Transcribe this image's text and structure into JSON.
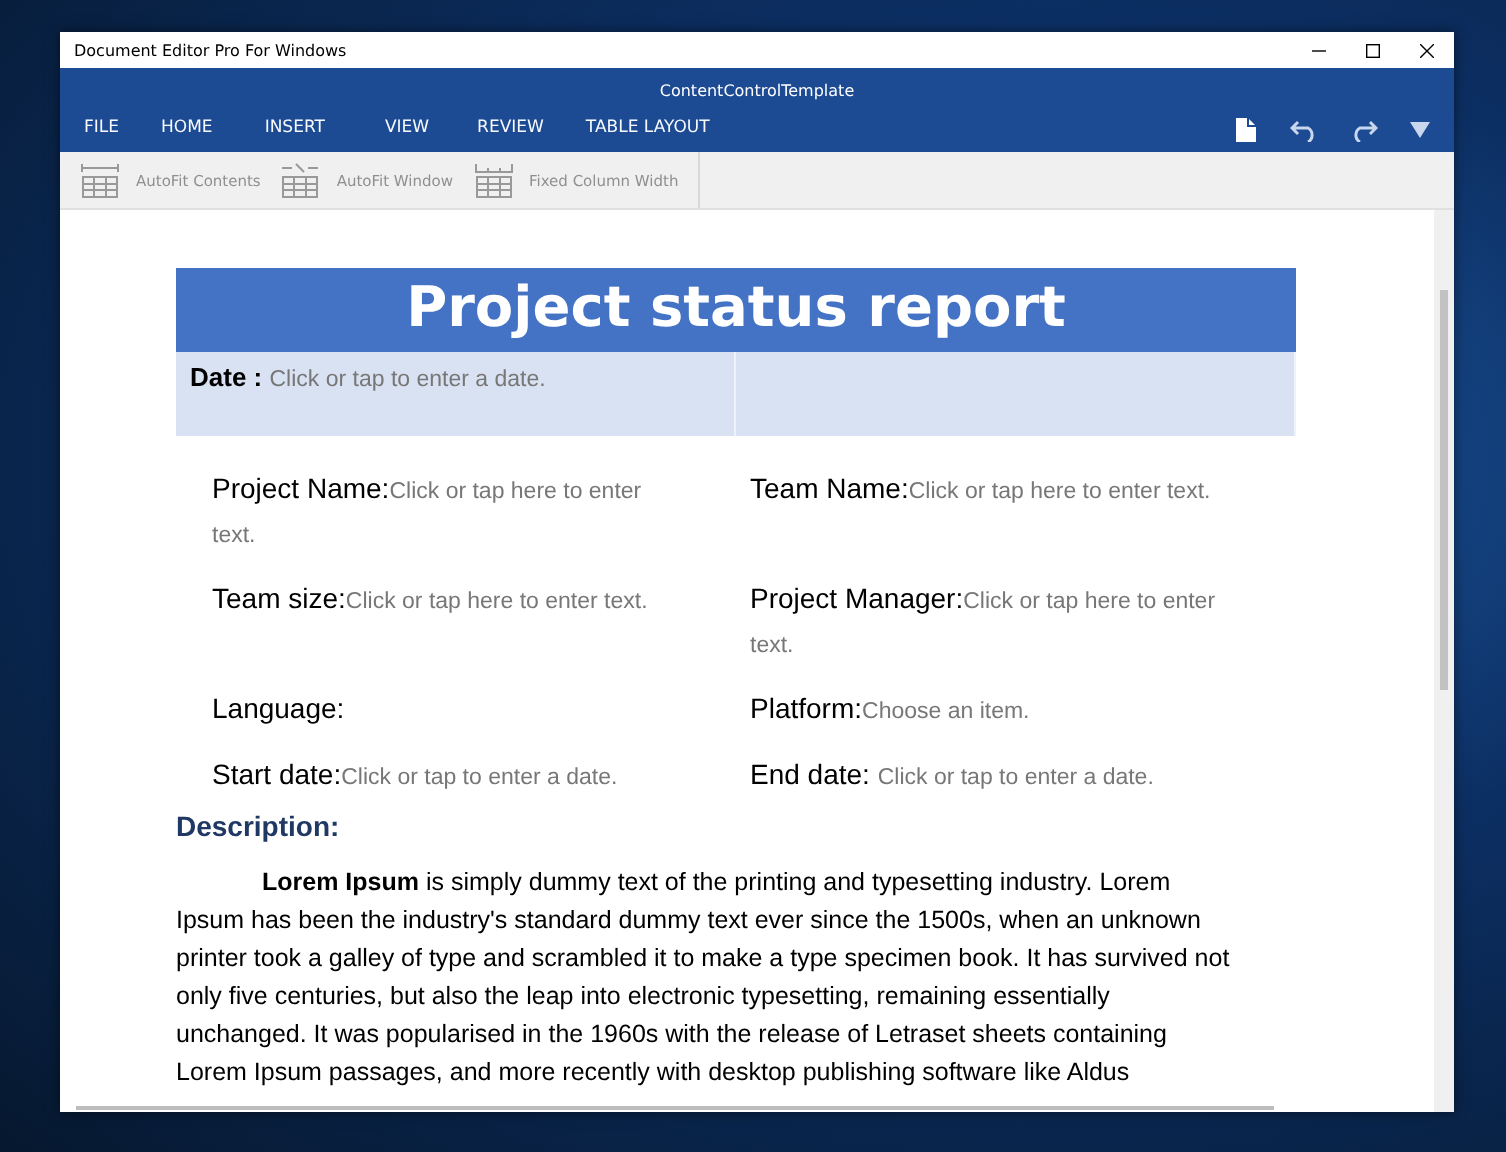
{
  "window": {
    "title": "Document Editor Pro For Windows",
    "document_title": "ContentControlTemplate"
  },
  "menu": [
    {
      "label": "FILE"
    },
    {
      "label": "HOME"
    },
    {
      "label": "INSERT"
    },
    {
      "label": "VIEW"
    },
    {
      "label": "REVIEW"
    },
    {
      "label": "TABLE LAYOUT"
    }
  ],
  "toolbar": [
    {
      "label": "AutoFit Contents",
      "kind": "contents",
      "disabled": true
    },
    {
      "label": "AutoFit Window",
      "kind": "window",
      "disabled": true
    },
    {
      "label": "Fixed Column Width",
      "kind": "fixed",
      "disabled": true
    }
  ],
  "document": {
    "heading": "Project status report",
    "date_label": "Date :",
    "date_placeholder": "Click or tap to enter a date.",
    "fields": [
      {
        "label": "Project Name:",
        "placeholder": "Click or tap here to enter text."
      },
      {
        "label": "Team Name:",
        "placeholder": "Click or tap here to enter text."
      },
      {
        "label": "Team size:",
        "placeholder": "Click or tap here to enter text."
      },
      {
        "label": "Project Manager:",
        "placeholder": "Click or tap here to enter text."
      },
      {
        "label": "Language:"
      },
      {
        "label": "Platform:",
        "placeholder": "Choose an item."
      },
      {
        "label": "Start date:",
        "placeholder": "Click or tap to enter a date."
      },
      {
        "label": "End date: ",
        "placeholder": "Click or tap to enter a date."
      }
    ],
    "description_heading": "Description:",
    "paragraph_lines": [
      "**Lorem Ipsum** is simply dummy text of the printing and typesetting industry. Lorem",
      "Ipsum has been the industry's standard dummy text ever since the 1500s, when an unknown",
      "printer took a galley of type and scrambled it to make a type specimen book. It has survived not",
      "only five centuries, but also the leap into electronic typesetting, remaining essentially",
      "unchanged. It was popularised in the 1960s with the release of Letraset sheets containing",
      "Lorem Ipsum passages, and more recently with desktop publishing software like Aldus"
    ]
  }
}
